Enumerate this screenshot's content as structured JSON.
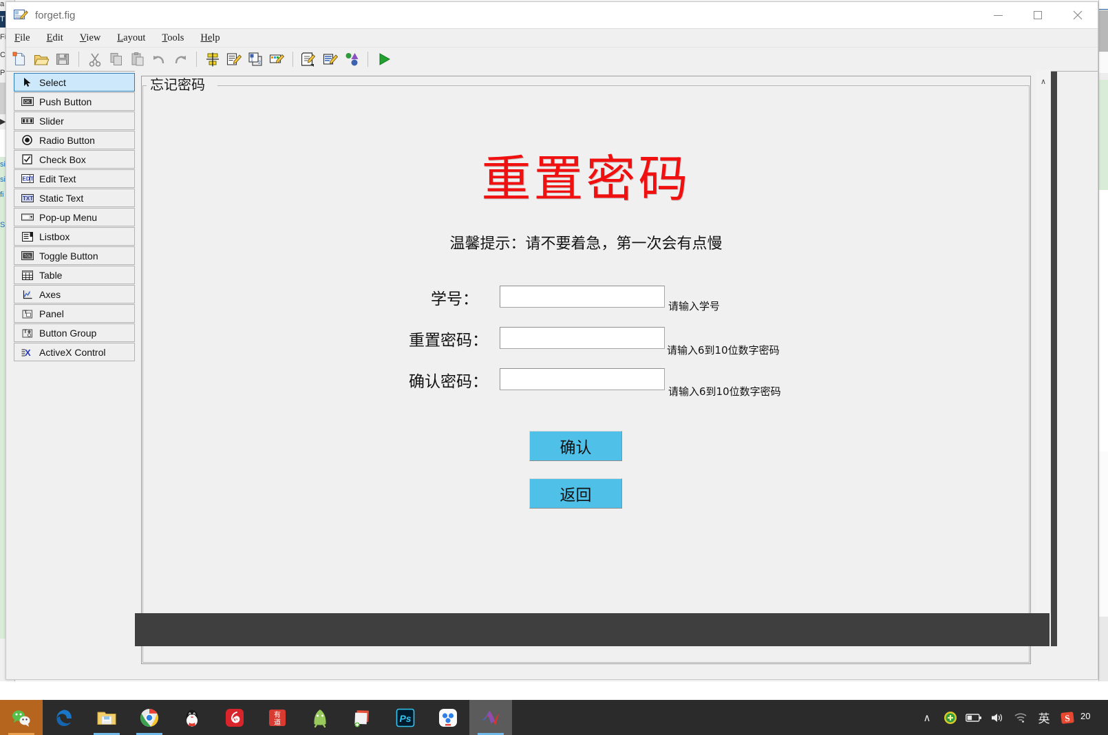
{
  "window": {
    "title": "forget.fig",
    "icon": "guide-figure-icon",
    "controls": {
      "minimize": "–",
      "maximize": "□",
      "close": "✕"
    }
  },
  "menubar": {
    "items": [
      {
        "name": "file",
        "accel": "F",
        "rest": "ile"
      },
      {
        "name": "edit",
        "accel": "E",
        "rest": "dit"
      },
      {
        "name": "view",
        "accel": "V",
        "rest": "iew"
      },
      {
        "name": "layout",
        "accel": "L",
        "rest": "ayout"
      },
      {
        "name": "tools",
        "accel": "T",
        "rest": "ools"
      },
      {
        "name": "help",
        "accel": "He",
        "rest": "lp"
      }
    ]
  },
  "toolbar": {
    "buttons": [
      "new-figure-icon",
      "open-icon",
      "save-icon",
      "cut-icon",
      "copy-icon",
      "paste-icon",
      "undo-icon",
      "redo-icon",
      "align-objects-icon",
      "menu-editor-icon",
      "tab-order-editor-icon",
      "toolbar-editor-icon",
      "m-file-editor-icon",
      "property-inspector-icon",
      "object-browser-icon",
      "run-icon"
    ]
  },
  "palette": {
    "items": [
      {
        "label": "Select",
        "icon": "cursor-arrow-icon",
        "selected": true
      },
      {
        "label": "Push Button",
        "icon": "push-button-icon",
        "selected": false
      },
      {
        "label": "Slider",
        "icon": "slider-icon",
        "selected": false
      },
      {
        "label": "Radio Button",
        "icon": "radio-button-icon",
        "selected": false
      },
      {
        "label": "Check Box",
        "icon": "check-box-icon",
        "selected": false
      },
      {
        "label": "Edit Text",
        "icon": "edit-text-icon",
        "selected": false
      },
      {
        "label": "Static Text",
        "icon": "static-text-icon",
        "selected": false
      },
      {
        "label": "Pop-up Menu",
        "icon": "popup-menu-icon",
        "selected": false
      },
      {
        "label": "Listbox",
        "icon": "listbox-icon",
        "selected": false
      },
      {
        "label": "Toggle Button",
        "icon": "toggle-button-icon",
        "selected": false
      },
      {
        "label": "Table",
        "icon": "table-icon",
        "selected": false
      },
      {
        "label": "Axes",
        "icon": "axes-icon",
        "selected": false
      },
      {
        "label": "Panel",
        "icon": "panel-icon",
        "selected": false
      },
      {
        "label": "Button Group",
        "icon": "button-group-icon",
        "selected": false
      },
      {
        "label": "ActiveX Control",
        "icon": "activex-control-icon",
        "selected": false
      }
    ]
  },
  "figure": {
    "panel_title": "忘记密码",
    "heading": "重置密码",
    "heading_color": "#f01010",
    "tip": "温馨提示：请不要着急，第一次会有点慢",
    "fields": [
      {
        "label": "学号：",
        "value": "",
        "hint": "请输入学号"
      },
      {
        "label": "重置密码：",
        "value": "",
        "hint": "请输入6到10位数字密码"
      },
      {
        "label": "确认密码：",
        "value": "",
        "hint": "请输入6到10位数字密码"
      }
    ],
    "buttons": [
      {
        "label": "确认",
        "color": "#4fc0e8"
      },
      {
        "label": "返回",
        "color": "#4fc0e8"
      }
    ],
    "scroll": {
      "up": "∧",
      "down": "∨"
    }
  },
  "taskbar": {
    "apps": [
      {
        "name": "wechat",
        "label": "WeChat"
      },
      {
        "name": "edge",
        "label": "Microsoft Edge"
      },
      {
        "name": "file-explorer",
        "label": "File Explorer"
      },
      {
        "name": "chrome",
        "label": "Google Chrome"
      },
      {
        "name": "qq",
        "label": "QQ"
      },
      {
        "name": "netease-music",
        "label": "NetEase Cloud Music"
      },
      {
        "name": "youdao",
        "label": "有道"
      },
      {
        "name": "android-studio",
        "label": "Android Studio"
      },
      {
        "name": "notes",
        "label": "Notes"
      },
      {
        "name": "photoshop",
        "label": "Ps"
      },
      {
        "name": "baidu-netdisk",
        "label": "Baidu Netdisk"
      },
      {
        "name": "matlab",
        "label": "MATLAB"
      }
    ],
    "tray": [
      {
        "name": "show-hidden-icons",
        "glyph": "∧"
      },
      {
        "name": "antivirus-icon",
        "glyph": ""
      },
      {
        "name": "battery-icon",
        "glyph": ""
      },
      {
        "name": "volume-icon",
        "glyph": ""
      },
      {
        "name": "wifi-icon",
        "glyph": ""
      },
      {
        "name": "ime-language-icon",
        "glyph": "英"
      },
      {
        "name": "sogou-input-icon",
        "glyph": "S"
      }
    ],
    "clock": "20"
  }
}
